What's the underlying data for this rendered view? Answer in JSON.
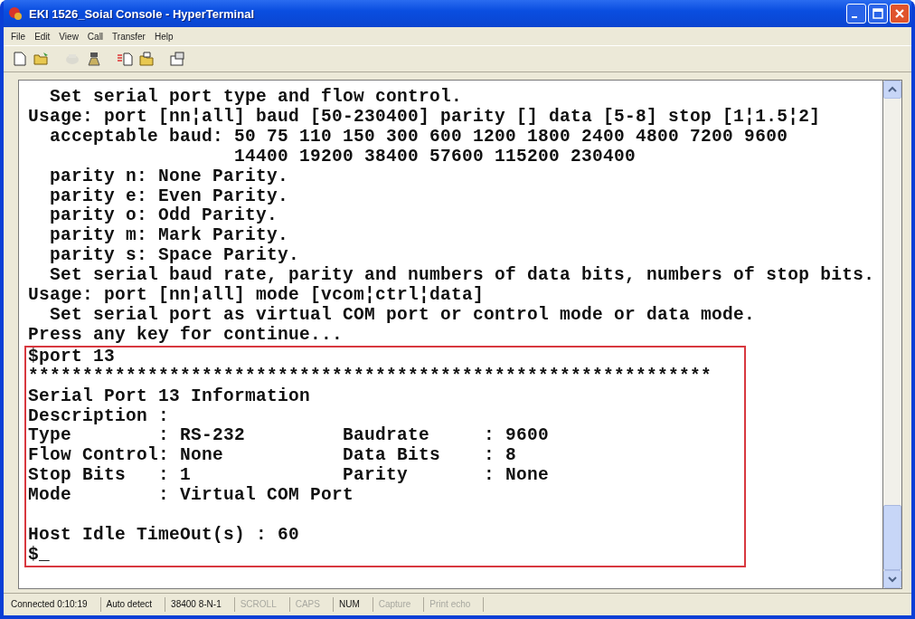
{
  "window": {
    "title": "EKI 1526_Soial Console - HyperTerminal"
  },
  "menu": [
    "File",
    "Edit",
    "View",
    "Call",
    "Transfer",
    "Help"
  ],
  "toolbar": [
    {
      "kind": "new",
      "disabled": false
    },
    {
      "kind": "open",
      "disabled": false
    },
    {
      "kind": "disconnect",
      "disabled": true
    },
    {
      "kind": "dial",
      "disabled": false
    },
    {
      "kind": "send",
      "disabled": false
    },
    {
      "kind": "receive",
      "disabled": false
    },
    {
      "kind": "properties",
      "disabled": false
    }
  ],
  "terminal": {
    "lines": [
      "  Set serial port type and flow control.",
      "Usage: port [nn¦all] baud [50-230400] parity [] data [5-8] stop [1¦1.5¦2]",
      "  acceptable baud: 50 75 110 150 300 600 1200 1800 2400 4800 7200 9600",
      "                   14400 19200 38400 57600 115200 230400",
      "  parity n: None Parity.",
      "  parity e: Even Parity.",
      "  parity o: Odd Parity.",
      "  parity m: Mark Parity.",
      "  parity s: Space Parity.",
      "  Set serial baud rate, parity and numbers of data bits, numbers of stop bits.",
      "Usage: port [nn¦all] mode [vcom¦ctrl¦data]",
      "  Set serial port as virtual COM port or control mode or data mode.",
      "Press any key for continue..."
    ],
    "highlighted_lines": [
      "$port 13",
      "***************************************************************",
      "Serial Port 13 Information",
      "Description :",
      "Type        : RS-232         Baudrate     : 9600",
      "Flow Control: None           Data Bits    : 8",
      "Stop Bits   : 1              Parity       : None",
      "Mode        : Virtual COM Port"
    ],
    "lines_after_blank": [
      "Host Idle TimeOut(s) : 60",
      "$_"
    ]
  },
  "status_bar": [
    {
      "text": "Connected 0:10:19",
      "active": true
    },
    {
      "text": "Auto detect",
      "active": true
    },
    {
      "text": "38400 8-N-1",
      "active": true
    },
    {
      "text": "SCROLL",
      "active": false
    },
    {
      "text": "CAPS",
      "active": false
    },
    {
      "text": "NUM",
      "active": true
    },
    {
      "text": "Capture",
      "active": false
    },
    {
      "text": "Print echo",
      "active": false
    }
  ]
}
